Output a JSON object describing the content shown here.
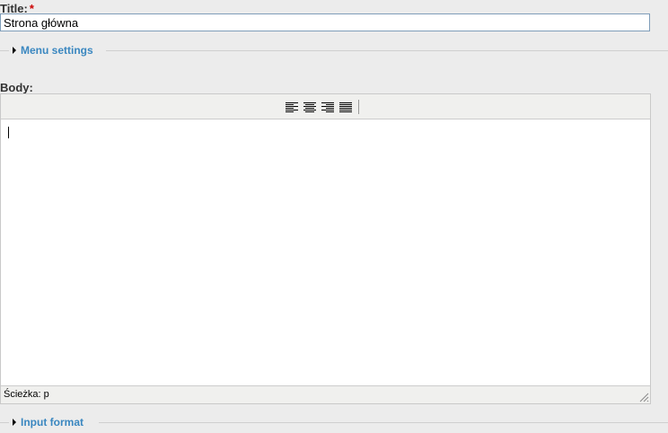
{
  "title_field": {
    "label": "Title:",
    "required_mark": "*",
    "value": "Strona główna"
  },
  "menu_settings": {
    "legend": "Menu settings"
  },
  "body_field": {
    "label": "Body:"
  },
  "editor": {
    "toolbar": {
      "buttons": [
        {
          "name": "align-left",
          "icon": "align-left-icon"
        },
        {
          "name": "align-center",
          "icon": "align-center-icon"
        },
        {
          "name": "align-right",
          "icon": "align-right-icon"
        },
        {
          "name": "justify",
          "icon": "justify-icon"
        }
      ]
    },
    "content": "",
    "path_label": "Ścieżka: p"
  },
  "input_format": {
    "legend": "Input format"
  },
  "colors": {
    "link": "#3a87c0",
    "required": "#cc0000",
    "page_bg": "#ececec",
    "input_border": "#7f9db9"
  }
}
